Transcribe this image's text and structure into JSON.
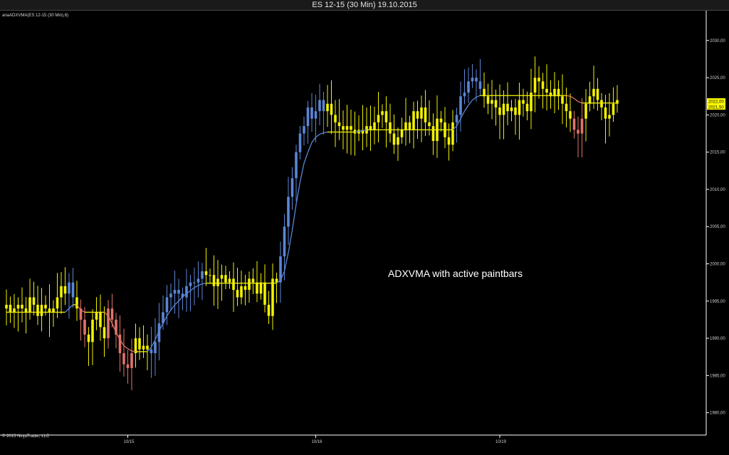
{
  "window": {
    "title": "ES 12-15 (30 Min)  19.10.2015"
  },
  "indicator_label": "anaADXVMA(ES 12-15 (30 Min),6)",
  "copyright": "© 2015 NinjaTrader, LLC",
  "annotation": "ADXVMA with active paintbars",
  "price_boxes": [
    "2022,00",
    "2021,50"
  ],
  "colors": {
    "background": "#000000",
    "neutral_bar": "#f2f200",
    "up_bar": "#5b86d6",
    "down_bar": "#e0736a",
    "vma_neutral": "#f2f200",
    "vma_up": "#5b86d6",
    "vma_down": "#e0736a",
    "axis": "#ffffff"
  },
  "chart_data": {
    "type": "candlestick",
    "title": "ES 12-15 (30 Min)  19.10.2015",
    "ylim": [
      1977,
      2034
    ],
    "yticks": [
      "1980,00",
      "1985,00",
      "1990,00",
      "1995,00",
      "2000,00",
      "2005,00",
      "2010,00",
      "2015,00",
      "2020,00",
      "2025,00",
      "2030,00"
    ],
    "xticks": [
      "10/15",
      "10/16",
      "10/19"
    ],
    "xtick_bar_index": [
      31,
      79,
      126
    ],
    "legend": "none",
    "grid": false,
    "closes": [
      1994.5,
      1993.5,
      1994.0,
      1994.5,
      1994.0,
      1993.5,
      1995.5,
      1994.5,
      1993.0,
      1994.5,
      1994.0,
      1993.5,
      1994.0,
      1995.5,
      1997.0,
      1996.0,
      1997.5,
      1995.5,
      1994.0,
      1992.5,
      1990.5,
      1989.5,
      1992.5,
      1993.5,
      1991.5,
      1990.0,
      1994.0,
      1992.5,
      1990.5,
      1988.0,
      1986.5,
      1986.0,
      1988.0,
      1990.0,
      1988.5,
      1989.0,
      1988.5,
      1988.0,
      1989.5,
      1992.0,
      1993.5,
      1995.5,
      1996.0,
      1996.5,
      1996.0,
      1995.5,
      1997.0,
      1997.5,
      1997.5,
      1998.0,
      1999.0,
      1998.5,
      1998.5,
      1997.0,
      1998.0,
      1998.5,
      1997.5,
      1998.0,
      1996.5,
      1995.5,
      1997.0,
      1996.5,
      1998.0,
      1997.5,
      1996.0,
      1997.5,
      1994.5,
      1993.0,
      1998.0,
      1997.5,
      2001.0,
      2005.0,
      2009.0,
      2011.5,
      2015.0,
      2017.5,
      2018.5,
      2021.0,
      2019.5,
      2020.5,
      2022.0,
      2020.5,
      2021.5,
      2020.0,
      2019.0,
      2018.5,
      2018.0,
      2018.5,
      2018.0,
      2017.5,
      2018.0,
      2017.5,
      2018.5,
      2018.0,
      2019.0,
      2020.0,
      2020.5,
      2019.0,
      2017.5,
      2016.0,
      2017.0,
      2018.0,
      2019.0,
      2018.0,
      2020.5,
      2019.5,
      2021.0,
      2019.0,
      2018.5,
      2016.5,
      2019.5,
      2019.0,
      2017.0,
      2016.0,
      2019.0,
      2020.0,
      2022.5,
      2023.0,
      2024.5,
      2025.0,
      2024.5,
      2023.5,
      2022.5,
      2021.5,
      2022.0,
      2021.0,
      2020.0,
      2021.5,
      2020.5,
      2021.0,
      2020.0,
      2022.0,
      2021.5,
      2020.5,
      2023.0,
      2025.0,
      2024.5,
      2023.5,
      2023.0,
      2022.5,
      2023.5,
      2022.5,
      2021.5,
      2020.5,
      2019.5,
      2018.0,
      2017.5,
      2019.5,
      2021.5,
      2022.5,
      2023.5,
      2022.0,
      2021.0,
      2019.5,
      2020.0,
      2021.5,
      2022.0
    ],
    "vma": [
      1993.5,
      1993.5,
      1993.5,
      1993.5,
      1993.5,
      1993.5,
      1993.5,
      1993.5,
      1993.5,
      1993.5,
      1993.5,
      1993.5,
      1993.5,
      1993.5,
      1993.5,
      1993.5,
      1994.0,
      1994.5,
      1994.5,
      1993.8,
      1993.5,
      1993.5,
      1993.5,
      1993.5,
      1993.5,
      1993.5,
      1993.0,
      1992.0,
      1990.8,
      1989.8,
      1989.0,
      1988.6,
      1988.3,
      1988.2,
      1988.2,
      1988.2,
      1988.2,
      1988.8,
      1989.8,
      1991.0,
      1992.0,
      1993.0,
      1993.8,
      1994.5,
      1995.0,
      1995.6,
      1996.0,
      1996.4,
      1996.8,
      1997.1,
      1997.3,
      1997.4,
      1997.4,
      1997.4,
      1997.4,
      1997.4,
      1997.4,
      1997.4,
      1997.4,
      1997.4,
      1997.4,
      1997.4,
      1997.4,
      1997.4,
      1997.4,
      1997.4,
      1997.4,
      1997.4,
      1997.4,
      1997.4,
      1997.8,
      1999.0,
      2001.5,
      2004.5,
      2008.0,
      2011.0,
      2013.5,
      2015.0,
      2016.3,
      2017.0,
      2017.4,
      2017.6,
      2017.7,
      2017.7,
      2017.7,
      2017.7,
      2017.7,
      2017.7,
      2017.7,
      2017.7,
      2017.8,
      2017.9,
      2018.0,
      2018.0,
      2018.0,
      2018.0,
      2018.0,
      2018.0,
      2018.0,
      2018.0,
      2018.0,
      2018.0,
      2018.0,
      2018.0,
      2018.0,
      2018.0,
      2018.0,
      2018.0,
      2018.0,
      2018.0,
      2018.0,
      2018.0,
      2018.0,
      2018.0,
      2018.0,
      2018.5,
      2019.5,
      2020.5,
      2021.3,
      2022.0,
      2022.4,
      2022.6,
      2022.6,
      2022.6,
      2022.6,
      2022.6,
      2022.6,
      2022.6,
      2022.6,
      2022.6,
      2022.6,
      2022.6,
      2022.6,
      2022.6,
      2022.6,
      2022.6,
      2022.6,
      2022.6,
      2022.6,
      2022.6,
      2022.6,
      2022.6,
      2022.6,
      2022.6,
      2022.5,
      2022.2,
      2021.8,
      2021.6,
      2021.6,
      2021.6,
      2021.6,
      2021.6,
      2021.6,
      2021.6,
      2021.6,
      2021.6,
      2021.6
    ]
  }
}
